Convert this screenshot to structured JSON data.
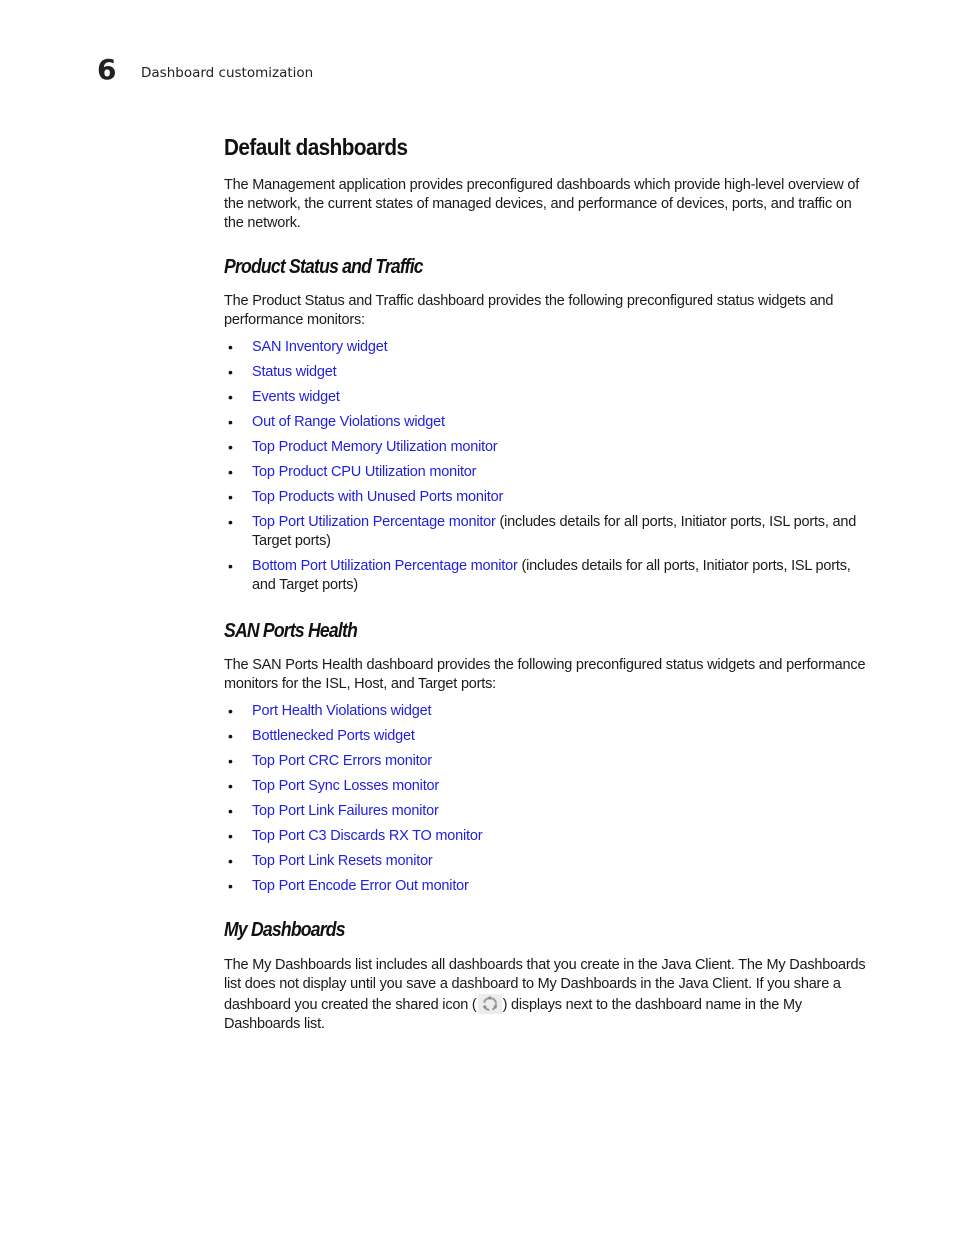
{
  "header": {
    "chapter_number": "6",
    "chapter_title": "Dashboard customization"
  },
  "page_title": "Default dashboards",
  "intro": "The Management application provides preconfigured dashboards which provide high-level overview of the network, the current states of managed devices, and performance of devices, ports, and traffic on the network.",
  "sections": [
    {
      "heading": "Product Status and Traffic",
      "description": "The Product Status and Traffic dashboard provides the following preconfigured status widgets and performance monitors:",
      "items": [
        {
          "link": "SAN Inventory widget",
          "suffix": ""
        },
        {
          "link": "Status widget",
          "suffix": ""
        },
        {
          "link": "Events widget",
          "suffix": ""
        },
        {
          "link": "Out of Range Violations widget",
          "suffix": ""
        },
        {
          "link": "Top Product Memory Utilization monitor",
          "suffix": ""
        },
        {
          "link": "Top Product CPU Utilization monitor",
          "suffix": ""
        },
        {
          "link": "Top Products with Unused Ports monitor",
          "suffix": ""
        },
        {
          "link": "Top Port Utilization Percentage monitor",
          "suffix": " (includes details for all ports, Initiator ports, ISL ports, and Target ports)"
        },
        {
          "link": "Bottom Port Utilization Percentage monitor",
          "suffix": " (includes details for all ports, Initiator ports, ISL ports, and Target ports)"
        }
      ]
    },
    {
      "heading": "SAN Ports Health",
      "description": "The SAN Ports Health dashboard provides the following preconfigured status widgets and performance monitors for the ISL, Host, and Target ports:",
      "items": [
        {
          "link": "Port Health Violations widget",
          "suffix": ""
        },
        {
          "link": "Bottlenecked Ports widget",
          "suffix": ""
        },
        {
          "link": "Top Port CRC Errors monitor",
          "suffix": ""
        },
        {
          "link": "Top Port Sync Losses monitor",
          "suffix": ""
        },
        {
          "link": "Top Port Link Failures monitor",
          "suffix": ""
        },
        {
          "link": "Top Port C3 Discards RX TO monitor",
          "suffix": ""
        },
        {
          "link": "Top Port Link Resets monitor",
          "suffix": ""
        },
        {
          "link": "Top Port Encode Error Out monitor",
          "suffix": ""
        }
      ]
    },
    {
      "heading": "My Dashboards",
      "text_before_icon": "The My Dashboards list includes all dashboards that you create in the Java Client. The My Dashboards list does not display until you save a dashboard to My Dashboards in the Java Client. If you share a dashboard you created the shared icon (",
      "icon": "shared-icon",
      "text_after_icon": ") displays next to the dashboard name in the My Dashboards list."
    }
  ],
  "bullet_glyph": "•",
  "colors": {
    "link": "#1f1fe0",
    "text": "#1a1a1a"
  }
}
